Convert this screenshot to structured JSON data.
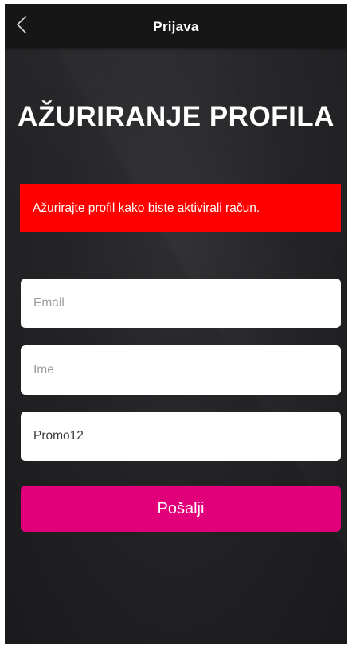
{
  "header": {
    "title": "Prijava",
    "back_icon": "chevron-left-icon"
  },
  "page": {
    "title": "AŽURIRANJE PROFILA"
  },
  "alert": {
    "message": "Ažurirajte profil kako biste aktivirali račun.",
    "color": "#ff0000"
  },
  "form": {
    "email": {
      "placeholder": "Email",
      "value": ""
    },
    "name": {
      "placeholder": "Ime",
      "value": ""
    },
    "promo": {
      "placeholder": "",
      "value": "Promo12"
    },
    "submit_label": "Pošalji",
    "submit_color": "#e2007a"
  }
}
